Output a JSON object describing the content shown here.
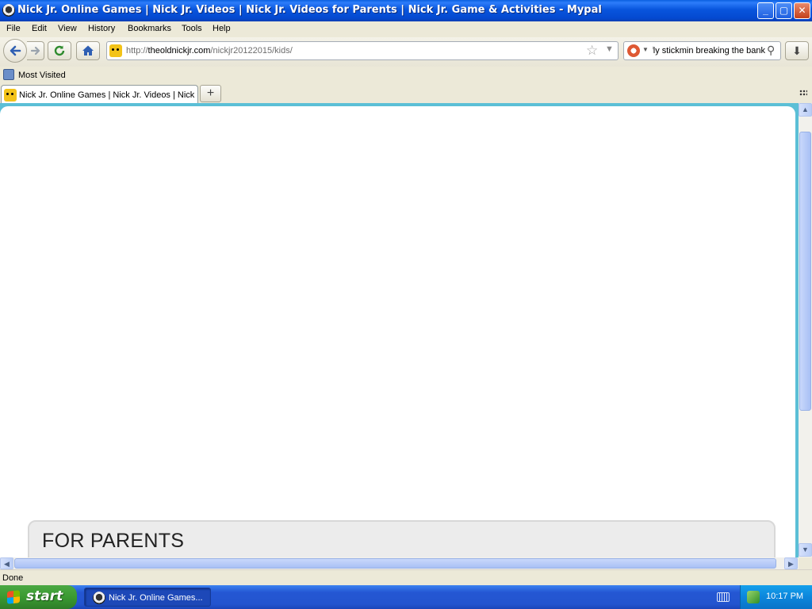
{
  "window": {
    "title": "Nick Jr. Online Games | Nick Jr. Videos | Nick Jr. Videos for Parents | Nick Jr. Game & Activities - Mypal",
    "min_glyph": "_",
    "max_glyph": "▢",
    "close_glyph": "✕"
  },
  "menu": {
    "file": "File",
    "edit": "Edit",
    "view": "View",
    "history": "History",
    "bookmarks": "Bookmarks",
    "tools": "Tools",
    "help": "Help"
  },
  "nav": {
    "url_prefix": "http://",
    "url_host": "theoldnickjr.com",
    "url_path": "/nickjr20122015/kids/",
    "search_query": "fly stickmin breaking the bank"
  },
  "bookmarks_bar": {
    "most_visited": "Most Visited"
  },
  "tabs": {
    "active_label": "Nick Jr. Online Games | Nick Jr. Videos | Nick ...",
    "new_tab": "+"
  },
  "page": {
    "for_parents": "FOR PARENTS"
  },
  "status": {
    "text": "Done"
  },
  "taskbar": {
    "start": "start",
    "task_item": "Nick Jr. Online Games...",
    "clock": "10:17 PM"
  },
  "colors": {
    "page_accent": "#5bbfd6",
    "titlebar": "#0855dd",
    "start_button": "#3a9a31"
  }
}
